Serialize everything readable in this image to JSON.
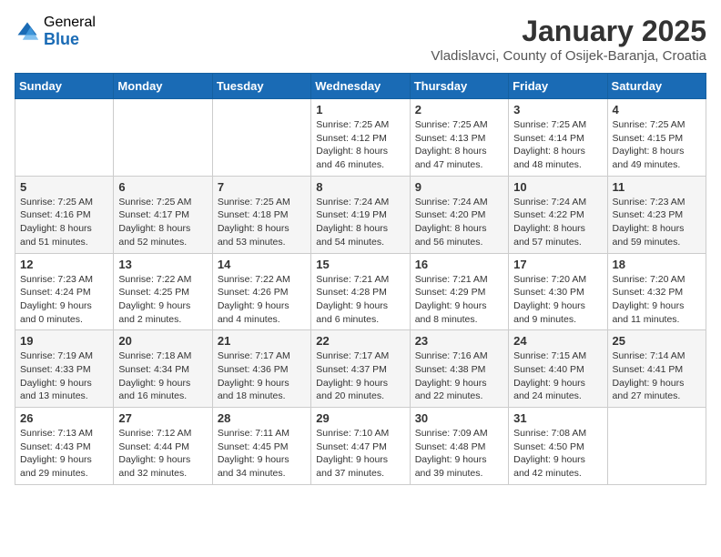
{
  "header": {
    "logo_general": "General",
    "logo_blue": "Blue",
    "month_year": "January 2025",
    "location": "Vladislavci, County of Osijek-Baranja, Croatia"
  },
  "days_of_week": [
    "Sunday",
    "Monday",
    "Tuesday",
    "Wednesday",
    "Thursday",
    "Friday",
    "Saturday"
  ],
  "weeks": [
    [
      {
        "day": "",
        "info": ""
      },
      {
        "day": "",
        "info": ""
      },
      {
        "day": "",
        "info": ""
      },
      {
        "day": "1",
        "sunrise": "Sunrise: 7:25 AM",
        "sunset": "Sunset: 4:12 PM",
        "daylight": "Daylight: 8 hours and 46 minutes."
      },
      {
        "day": "2",
        "sunrise": "Sunrise: 7:25 AM",
        "sunset": "Sunset: 4:13 PM",
        "daylight": "Daylight: 8 hours and 47 minutes."
      },
      {
        "day": "3",
        "sunrise": "Sunrise: 7:25 AM",
        "sunset": "Sunset: 4:14 PM",
        "daylight": "Daylight: 8 hours and 48 minutes."
      },
      {
        "day": "4",
        "sunrise": "Sunrise: 7:25 AM",
        "sunset": "Sunset: 4:15 PM",
        "daylight": "Daylight: 8 hours and 49 minutes."
      }
    ],
    [
      {
        "day": "5",
        "sunrise": "Sunrise: 7:25 AM",
        "sunset": "Sunset: 4:16 PM",
        "daylight": "Daylight: 8 hours and 51 minutes."
      },
      {
        "day": "6",
        "sunrise": "Sunrise: 7:25 AM",
        "sunset": "Sunset: 4:17 PM",
        "daylight": "Daylight: 8 hours and 52 minutes."
      },
      {
        "day": "7",
        "sunrise": "Sunrise: 7:25 AM",
        "sunset": "Sunset: 4:18 PM",
        "daylight": "Daylight: 8 hours and 53 minutes."
      },
      {
        "day": "8",
        "sunrise": "Sunrise: 7:24 AM",
        "sunset": "Sunset: 4:19 PM",
        "daylight": "Daylight: 8 hours and 54 minutes."
      },
      {
        "day": "9",
        "sunrise": "Sunrise: 7:24 AM",
        "sunset": "Sunset: 4:20 PM",
        "daylight": "Daylight: 8 hours and 56 minutes."
      },
      {
        "day": "10",
        "sunrise": "Sunrise: 7:24 AM",
        "sunset": "Sunset: 4:22 PM",
        "daylight": "Daylight: 8 hours and 57 minutes."
      },
      {
        "day": "11",
        "sunrise": "Sunrise: 7:23 AM",
        "sunset": "Sunset: 4:23 PM",
        "daylight": "Daylight: 8 hours and 59 minutes."
      }
    ],
    [
      {
        "day": "12",
        "sunrise": "Sunrise: 7:23 AM",
        "sunset": "Sunset: 4:24 PM",
        "daylight": "Daylight: 9 hours and 0 minutes."
      },
      {
        "day": "13",
        "sunrise": "Sunrise: 7:22 AM",
        "sunset": "Sunset: 4:25 PM",
        "daylight": "Daylight: 9 hours and 2 minutes."
      },
      {
        "day": "14",
        "sunrise": "Sunrise: 7:22 AM",
        "sunset": "Sunset: 4:26 PM",
        "daylight": "Daylight: 9 hours and 4 minutes."
      },
      {
        "day": "15",
        "sunrise": "Sunrise: 7:21 AM",
        "sunset": "Sunset: 4:28 PM",
        "daylight": "Daylight: 9 hours and 6 minutes."
      },
      {
        "day": "16",
        "sunrise": "Sunrise: 7:21 AM",
        "sunset": "Sunset: 4:29 PM",
        "daylight": "Daylight: 9 hours and 8 minutes."
      },
      {
        "day": "17",
        "sunrise": "Sunrise: 7:20 AM",
        "sunset": "Sunset: 4:30 PM",
        "daylight": "Daylight: 9 hours and 9 minutes."
      },
      {
        "day": "18",
        "sunrise": "Sunrise: 7:20 AM",
        "sunset": "Sunset: 4:32 PM",
        "daylight": "Daylight: 9 hours and 11 minutes."
      }
    ],
    [
      {
        "day": "19",
        "sunrise": "Sunrise: 7:19 AM",
        "sunset": "Sunset: 4:33 PM",
        "daylight": "Daylight: 9 hours and 13 minutes."
      },
      {
        "day": "20",
        "sunrise": "Sunrise: 7:18 AM",
        "sunset": "Sunset: 4:34 PM",
        "daylight": "Daylight: 9 hours and 16 minutes."
      },
      {
        "day": "21",
        "sunrise": "Sunrise: 7:17 AM",
        "sunset": "Sunset: 4:36 PM",
        "daylight": "Daylight: 9 hours and 18 minutes."
      },
      {
        "day": "22",
        "sunrise": "Sunrise: 7:17 AM",
        "sunset": "Sunset: 4:37 PM",
        "daylight": "Daylight: 9 hours and 20 minutes."
      },
      {
        "day": "23",
        "sunrise": "Sunrise: 7:16 AM",
        "sunset": "Sunset: 4:38 PM",
        "daylight": "Daylight: 9 hours and 22 minutes."
      },
      {
        "day": "24",
        "sunrise": "Sunrise: 7:15 AM",
        "sunset": "Sunset: 4:40 PM",
        "daylight": "Daylight: 9 hours and 24 minutes."
      },
      {
        "day": "25",
        "sunrise": "Sunrise: 7:14 AM",
        "sunset": "Sunset: 4:41 PM",
        "daylight": "Daylight: 9 hours and 27 minutes."
      }
    ],
    [
      {
        "day": "26",
        "sunrise": "Sunrise: 7:13 AM",
        "sunset": "Sunset: 4:43 PM",
        "daylight": "Daylight: 9 hours and 29 minutes."
      },
      {
        "day": "27",
        "sunrise": "Sunrise: 7:12 AM",
        "sunset": "Sunset: 4:44 PM",
        "daylight": "Daylight: 9 hours and 32 minutes."
      },
      {
        "day": "28",
        "sunrise": "Sunrise: 7:11 AM",
        "sunset": "Sunset: 4:45 PM",
        "daylight": "Daylight: 9 hours and 34 minutes."
      },
      {
        "day": "29",
        "sunrise": "Sunrise: 7:10 AM",
        "sunset": "Sunset: 4:47 PM",
        "daylight": "Daylight: 9 hours and 37 minutes."
      },
      {
        "day": "30",
        "sunrise": "Sunrise: 7:09 AM",
        "sunset": "Sunset: 4:48 PM",
        "daylight": "Daylight: 9 hours and 39 minutes."
      },
      {
        "day": "31",
        "sunrise": "Sunrise: 7:08 AM",
        "sunset": "Sunset: 4:50 PM",
        "daylight": "Daylight: 9 hours and 42 minutes."
      },
      {
        "day": "",
        "info": ""
      }
    ]
  ]
}
